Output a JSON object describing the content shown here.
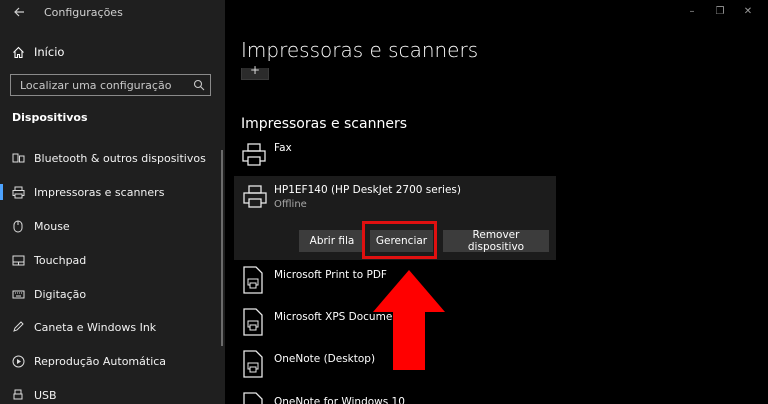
{
  "window": {
    "title": "Configurações",
    "controls": [
      "–",
      "❐",
      "✕"
    ]
  },
  "sidebar": {
    "home_label": "Início",
    "search_placeholder": "Localizar uma configuração",
    "section": "Dispositivos",
    "items": [
      {
        "label": "Bluetooth & outros dispositivos",
        "icon": "bluetooth-icon"
      },
      {
        "label": "Impressoras e scanners",
        "icon": "printer-icon",
        "active": true
      },
      {
        "label": "Mouse",
        "icon": "mouse-icon"
      },
      {
        "label": "Touchpad",
        "icon": "touchpad-icon"
      },
      {
        "label": "Digitação",
        "icon": "keyboard-icon"
      },
      {
        "label": "Caneta e Windows Ink",
        "icon": "pen-icon"
      },
      {
        "label": "Reprodução Automática",
        "icon": "autoplay-icon"
      },
      {
        "label": "USB",
        "icon": "usb-icon"
      }
    ]
  },
  "main": {
    "title": "Impressoras e scanners",
    "add_button_symbol": "+",
    "subheading": "Impressoras e scanners",
    "printers": [
      {
        "name": "Fax",
        "status": ""
      },
      {
        "name": "HP1EF140 (HP DeskJet 2700 series)",
        "status": "Offline"
      },
      {
        "name": "Microsoft Print to PDF",
        "status": ""
      },
      {
        "name": "Microsoft XPS Docume",
        "status": ""
      },
      {
        "name": "OneNote (Desktop)",
        "status": ""
      },
      {
        "name": "OneNote for Windows 10",
        "status": ""
      }
    ],
    "actions": {
      "open_queue": "Abrir fila",
      "manage": "Gerenciar",
      "remove": "Remover dispositivo"
    }
  },
  "annotation": {
    "highlight_color": "#e01010",
    "arrow_color": "#ff0000"
  }
}
